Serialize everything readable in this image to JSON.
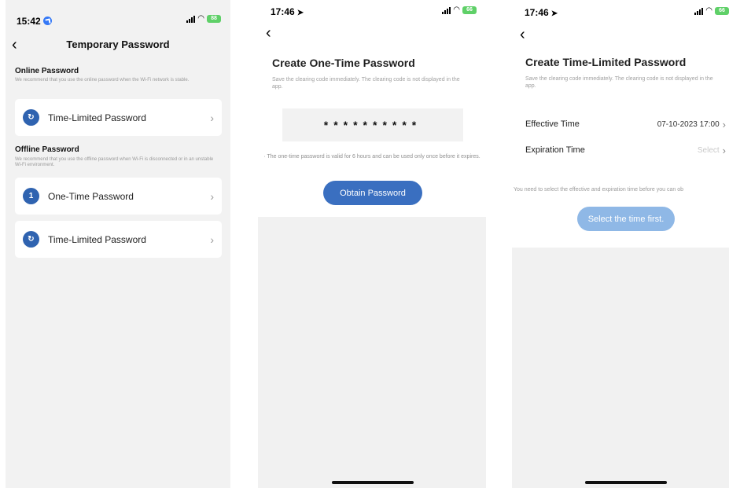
{
  "screens": {
    "temporary": {
      "status_time": "15:42",
      "battery": "88",
      "nav_title": "Temporary Password",
      "online_title": "Online Password",
      "online_desc": "We recommend that you use the online password when the Wi-Fi network is stable.",
      "online_items": [
        {
          "label": "Time-Limited Password",
          "badge": "↻"
        }
      ],
      "offline_title": "Offline Password",
      "offline_desc": "We recommend that you use the offline password when Wi-Fi is disconnected or in an unstable Wi-Fi environment.",
      "offline_items": [
        {
          "label": "One-Time Password",
          "badge": "1"
        },
        {
          "label": "Time-Limited Password",
          "badge": "↻"
        }
      ]
    },
    "one_time": {
      "status_time": "17:46",
      "battery": "66",
      "title": "Create One-Time Password",
      "desc": "Save the clearing code immediately. The clearing code is not displayed in the app.",
      "password_mask": "**********",
      "note": "· The one-time password is valid for 6 hours and can be used only once before it expires.",
      "button_label": "Obtain Password"
    },
    "time_limited": {
      "status_time": "17:46",
      "battery": "66",
      "title": "Create Time-Limited Password",
      "desc": "Save the clearing code immediately. The clearing code is not displayed in the app.",
      "effective_label": "Effective Time",
      "effective_value": "07-10-2023 17:00",
      "expiration_label": "Expiration Time",
      "expiration_placeholder": "Select",
      "note": "You need to select the effective and expiration time before you can ob",
      "button_label": "Select the time first."
    }
  },
  "colors": {
    "accent": "#2f63b0",
    "button_active": "#3a6fc0",
    "button_disabled": "#8fb8e6",
    "background_gray": "#f2f2f2"
  },
  "icons": {
    "back": "chevron-left-icon",
    "row": "chevron-right-icon",
    "location": "location-arrow-icon",
    "signal": "signal-icon",
    "wifi": "wifi-icon",
    "battery": "battery-icon"
  }
}
